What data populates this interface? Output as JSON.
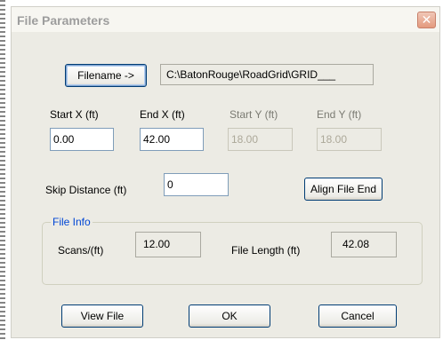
{
  "dialog": {
    "title": "File Parameters",
    "close_glyph": "✕"
  },
  "filename": {
    "button_label": "Filename ->",
    "path_value": "C:\\BatonRouge\\RoadGrid\\GRID___"
  },
  "coords": {
    "start_x_label": "Start X  (ft)",
    "end_x_label": "End X  (ft)",
    "start_y_label": "Start Y (ft)",
    "end_y_label": "End Y  (ft)",
    "start_x_value": "0.00",
    "end_x_value": "42.00",
    "start_y_value": "18.00",
    "end_y_value": "18.00"
  },
  "skip": {
    "label": "Skip Distance  (ft)",
    "value": "0"
  },
  "align_button_label": "Align File End",
  "file_info": {
    "group_title": "File Info",
    "scans_label": "Scans/(ft)",
    "scans_value": "12.00",
    "length_label": "File Length   (ft)",
    "length_value": "42.08"
  },
  "footer": {
    "view_label": "View File",
    "ok_label": "OK",
    "cancel_label": "Cancel"
  }
}
